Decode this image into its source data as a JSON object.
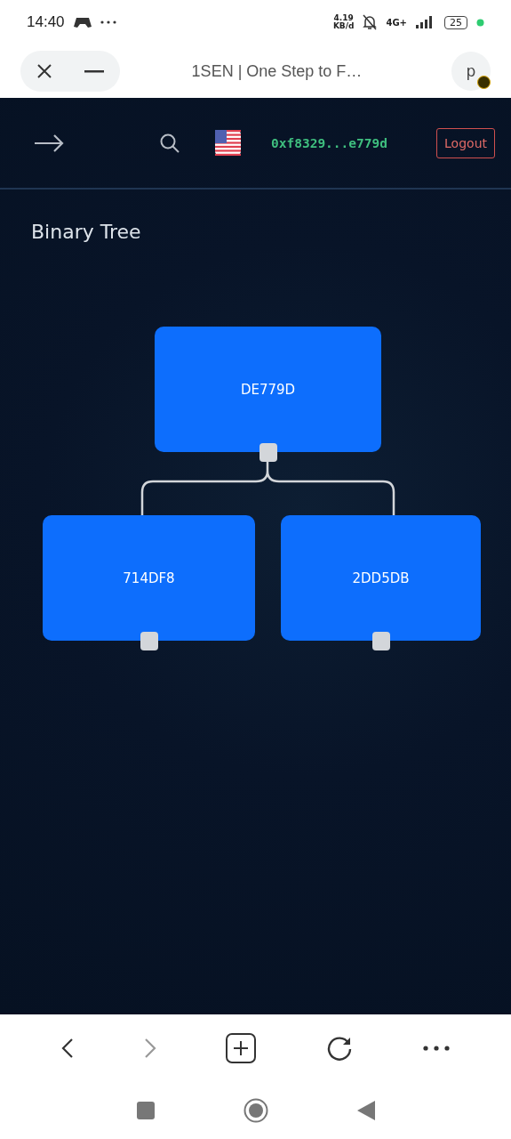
{
  "status_bar": {
    "time": "14:40",
    "speed": "4.19",
    "speed_unit": "KB/d",
    "network": "4G+",
    "battery": "25"
  },
  "browser_bar": {
    "title": "1SEN | One Step to F…",
    "profile": "p"
  },
  "header": {
    "wallet": "0xf8329...e779d",
    "logout": "Logout"
  },
  "page_title": "Binary Tree",
  "tree": {
    "label": "DE779D",
    "children": [
      {
        "label": "714DF8"
      },
      {
        "label": "2DD5DB"
      }
    ]
  },
  "bottom_bar": {
    "forward_disabled": true
  }
}
